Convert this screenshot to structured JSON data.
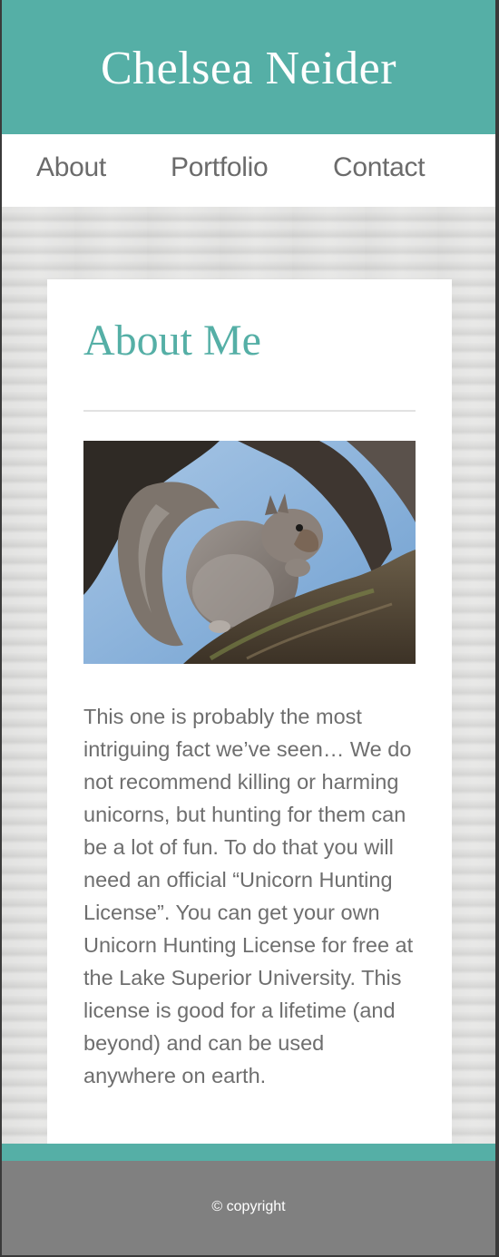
{
  "header": {
    "title": "Chelsea Neider"
  },
  "nav": {
    "items": [
      {
        "label": "About"
      },
      {
        "label": "Portfolio"
      },
      {
        "label": "Contact"
      }
    ]
  },
  "main": {
    "heading": "About Me",
    "image_subject": "squirrel-on-tree-branch",
    "bio": "This one is probably the most intriguing fact we’ve seen… We do not recommend killing or harming unicorns, but hunting for them can be a lot of fun. To do that you will need an official “Unicorn Hunting License”. You can get your own Unicorn Hunting License for free at the Lake Superior University. This license is good for a lifetime (and beyond) and can be used anywhere on earth."
  },
  "footer": {
    "copyright": "© copyright"
  },
  "colors": {
    "accent": "#55afa6",
    "nav_text": "#6b6b6b",
    "body_text": "#6e6e6e",
    "footer_bg": "#808080"
  }
}
